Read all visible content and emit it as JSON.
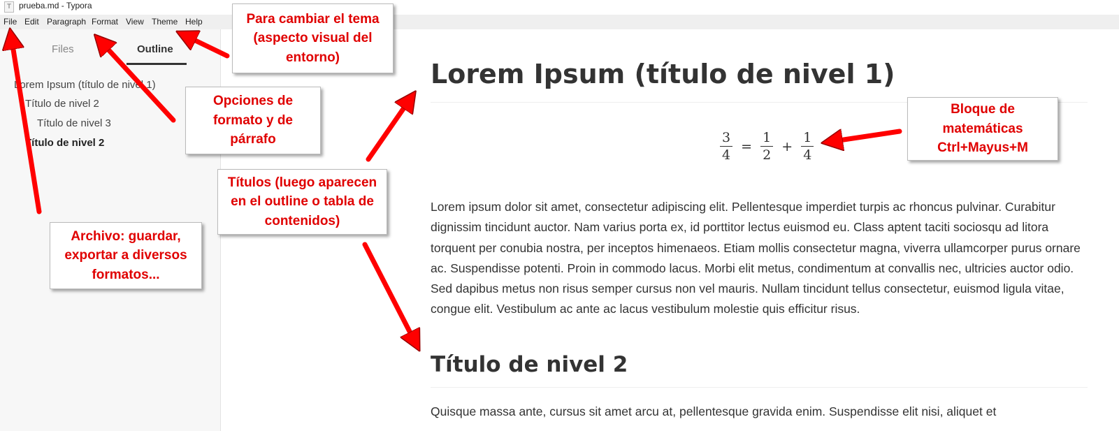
{
  "window": {
    "title": "prueba.md - Typora",
    "icon_letter": "T"
  },
  "menu": [
    "File",
    "Edit",
    "Paragraph",
    "Format",
    "View",
    "Theme",
    "Help"
  ],
  "sidebar": {
    "tabs": {
      "files": "Files",
      "outline": "Outline"
    },
    "outline": [
      "Lorem Ipsum (título de nivel 1)",
      "Título de nivel 2",
      "Título de nivel 3",
      "Título de nivel 2"
    ]
  },
  "document": {
    "h1": "Lorem Ipsum (título de nivel 1)",
    "math": {
      "f1_num": "3",
      "f1_den": "4",
      "eq": "=",
      "f2_num": "1",
      "f2_den": "2",
      "plus": "+",
      "f3_num": "1",
      "f3_den": "4"
    },
    "paragraph1": "Lorem ipsum dolor sit amet, consectetur adipiscing elit. Pellentesque imperdiet turpis ac rhoncus pulvinar. Curabitur dignissim tincidunt auctor. Nam varius porta ex, id porttitor lectus euismod eu. Class aptent taciti sociosqu ad litora torquent per conubia nostra, per inceptos himenaeos. Etiam mollis consectetur magna, viverra ullamcorper purus ornare ac. Suspendisse potenti. Proin in commodo lacus. Morbi elit metus, condimentum at convallis nec, ultricies auctor odio. Sed dapibus metus non risus semper cursus non vel mauris. Nullam tincidunt tellus consectetur, euismod ligula vitae, congue elit. Vestibulum ac ante ac lacus vestibulum molestie quis efficitur risus.",
    "h2": "Título de nivel 2",
    "paragraph2": "Quisque massa ante, cursus sit amet arcu at, pellentesque gravida enim. Suspendisse elit nisi, aliquet et"
  },
  "callouts": {
    "theme": "Para cambiar el tema (aspecto visual del entorno)",
    "format": "Opciones de formato y de párrafo",
    "file": "Archivo: guardar, exportar a diversos formatos...",
    "titles": "Títulos (luego aparecen en el outline o tabla de contenidos)",
    "math": "Bloque de matemáticas Ctrl+Mayus+M"
  },
  "colors": {
    "callout_text": "#e00000",
    "arrow": "#ff0000",
    "menubar": "#efefef",
    "sidebar": "#f7f7f7"
  }
}
